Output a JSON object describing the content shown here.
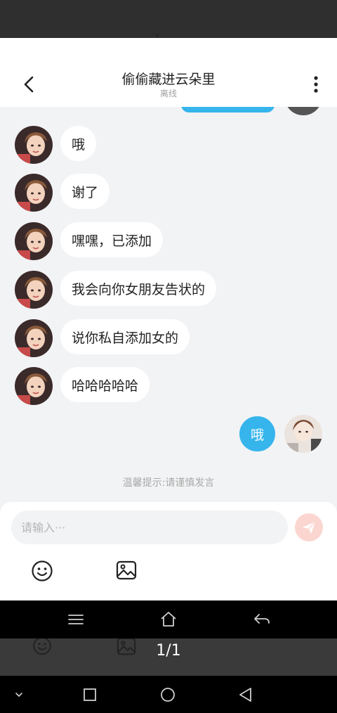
{
  "header": {
    "title": "偷偷藏进云朵里",
    "status": "离线"
  },
  "messages": [
    {
      "from": "other",
      "text": "哦"
    },
    {
      "from": "other",
      "text": "谢了"
    },
    {
      "from": "other",
      "text": "嘿嘿，已添加"
    },
    {
      "from": "other",
      "text": "我会向你女朋友告状的"
    },
    {
      "from": "other",
      "text": "说你私自添加女的"
    },
    {
      "from": "other",
      "text": "哈哈哈哈哈"
    },
    {
      "from": "me",
      "text": "哦"
    }
  ],
  "tip": "温馨提示:请谨慎发言",
  "composer": {
    "placeholder": "请输入···"
  },
  "viewer": {
    "counter": "1/1"
  },
  "colors": {
    "accent": "#35b5ec",
    "send": "#fbd6d0",
    "background": "#f2f3f5"
  },
  "icons": {
    "back": "chevron-left-icon",
    "more": "more-vertical-icon",
    "send": "send-icon",
    "emoji": "emoji-icon",
    "image": "image-icon",
    "menu": "menu-icon",
    "home": "home-icon",
    "back_nav": "return-icon"
  }
}
